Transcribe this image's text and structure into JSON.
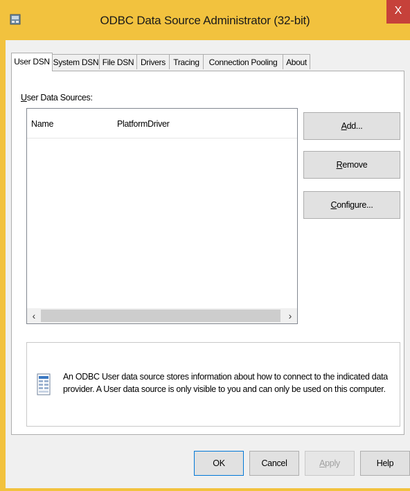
{
  "window": {
    "title": "ODBC Data Source Administrator (32-bit)",
    "close_label": "X"
  },
  "tabs": [
    {
      "label": "User DSN"
    },
    {
      "label": "System DSN"
    },
    {
      "label": "File DSN"
    },
    {
      "label": "Drivers"
    },
    {
      "label": "Tracing"
    },
    {
      "label": "Connection Pooling"
    },
    {
      "label": "About"
    }
  ],
  "user_dsn": {
    "section_label": "User Data Sources:",
    "columns": [
      "Name",
      "Platform",
      "Driver"
    ],
    "rows": [],
    "scroll_left": "‹",
    "scroll_right": "›",
    "buttons": {
      "add": {
        "mnemonic": "A",
        "rest": "dd..."
      },
      "remove": {
        "mnemonic": "R",
        "rest": "emove"
      },
      "configure": {
        "mnemonic": "C",
        "rest": "onfigure..."
      }
    },
    "info_text": "An ODBC User data source stores information about how to connect to the indicated data provider.  A User data source is only visible to you and can only be used on this computer."
  },
  "dialog_buttons": {
    "ok": "OK",
    "cancel": "Cancel",
    "apply": {
      "mnemonic": "A",
      "rest": "pply"
    },
    "help": "Help"
  },
  "colors": {
    "accent_frame": "#f2c23e",
    "close_button": "#c6413a",
    "default_button_border": "#0078d7"
  }
}
